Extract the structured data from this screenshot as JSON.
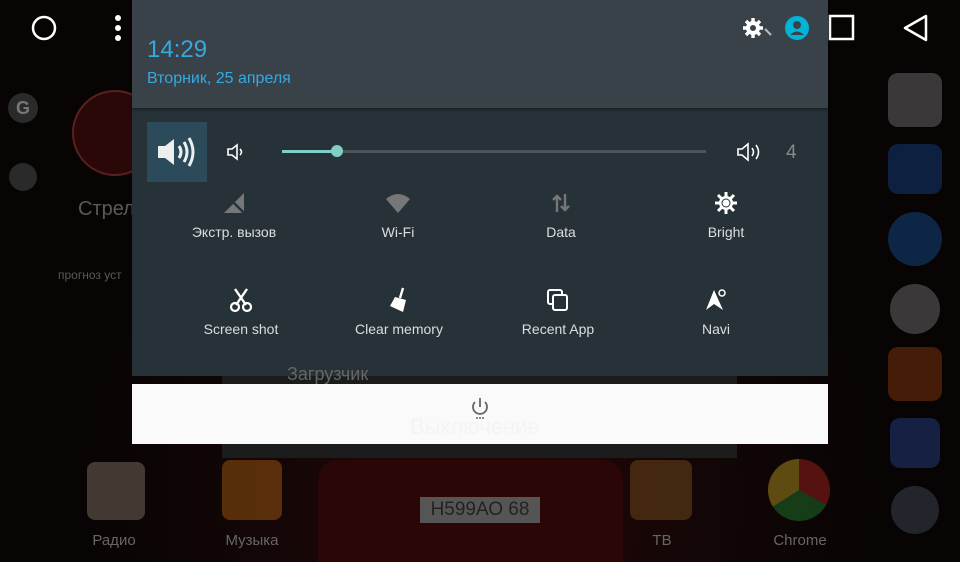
{
  "navbar": {
    "icons": [
      "circle-icon",
      "more-vert-icon",
      "square-icon",
      "back-triangle-icon"
    ]
  },
  "background": {
    "widget_title": "Стрел",
    "widget_sub": "прогноз уст",
    "menu_item": "Загрузчик",
    "power_label": "Выключение",
    "plate": "Н599АО 68",
    "dock": [
      {
        "label": "Радио"
      },
      {
        "label": "Музыка"
      },
      {
        "label": "ТВ"
      },
      {
        "label": "Chrome"
      }
    ]
  },
  "header": {
    "time": "14:29",
    "date": "Вторник, 25 апреля",
    "accent": "#36a9e0"
  },
  "volume": {
    "level": 4,
    "fraction": 0.13,
    "accent": "#7fcfc6"
  },
  "tiles": [
    {
      "label": "Экстр. вызов",
      "icon": "no-signal-icon",
      "active": false
    },
    {
      "label": "Wi-Fi",
      "icon": "wifi-icon",
      "active": false
    },
    {
      "label": "Data",
      "icon": "data-arrows-icon",
      "active": false
    },
    {
      "label": "Bright",
      "icon": "brightness-icon",
      "active": true
    },
    {
      "label": "Screen shot",
      "icon": "scissors-icon",
      "active": true
    },
    {
      "label": "Clear memory",
      "icon": "broom-icon",
      "active": true
    },
    {
      "label": "Recent App",
      "icon": "recent-apps-icon",
      "active": true
    },
    {
      "label": "Navi",
      "icon": "navigation-icon",
      "active": true
    }
  ]
}
